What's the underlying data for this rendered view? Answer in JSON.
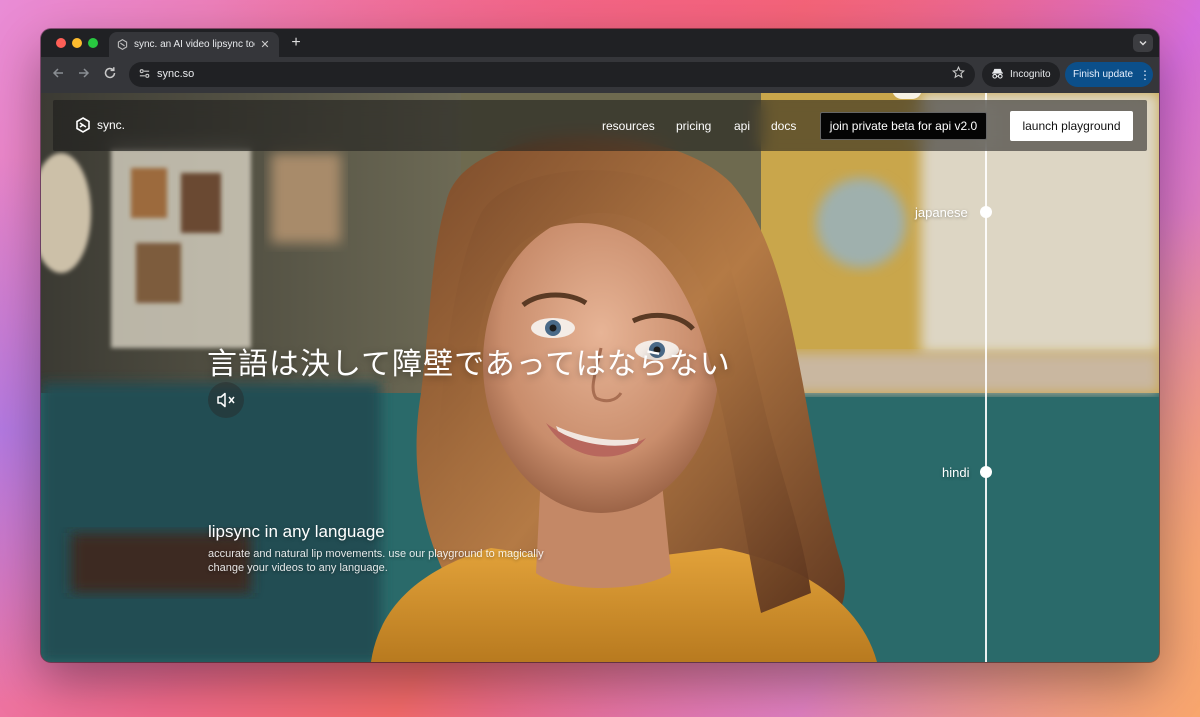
{
  "browser": {
    "tab_title": "sync. an AI video lipsync tool",
    "tab_close": "✕",
    "new_tab": "+",
    "url": "sync.so",
    "incognito_label": "Incognito",
    "finish_update_label": "Finish update"
  },
  "site": {
    "brand": "sync.",
    "nav": {
      "resources": "resources",
      "pricing": "pricing",
      "api": "api",
      "docs": "docs"
    },
    "beta_button": "join private beta for api v2.0",
    "launch_button": "launch playground",
    "languages": [
      "japanese",
      "hindi"
    ],
    "caption": "言語は決して障壁であってはならない",
    "heading": "lipsync in any language",
    "description": "accurate and natural lip movements. use our playground to magically change your videos to any language."
  }
}
